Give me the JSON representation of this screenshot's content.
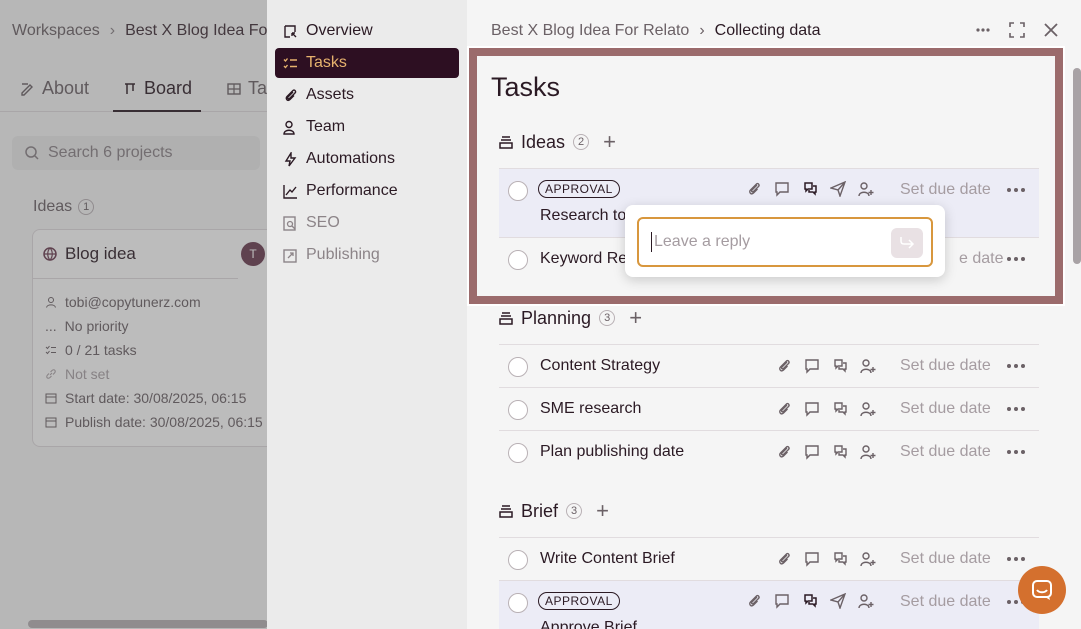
{
  "background": {
    "breadcrumb": {
      "root": "Workspaces",
      "current": "Best X Blog Idea For"
    },
    "tabs": [
      {
        "label": "About"
      },
      {
        "label": "Board"
      },
      {
        "label": "Ta"
      }
    ],
    "search_placeholder": "Search 6 projects",
    "column": {
      "title": "Ideas",
      "count": "1"
    },
    "card": {
      "title": "Blog idea",
      "avatar": "T",
      "email": "tobi@copytunerz.com",
      "priority": "No priority",
      "tasks": "0 / 21 tasks",
      "not_set": "Not set",
      "start_date": "Start date: 30/08/2025, 06:15",
      "publish_date": "Publish date: 30/08/2025, 06:15"
    }
  },
  "nav": {
    "items": [
      {
        "label": "Overview"
      },
      {
        "label": "Tasks"
      },
      {
        "label": "Assets"
      },
      {
        "label": "Team"
      },
      {
        "label": "Automations"
      },
      {
        "label": "Performance"
      },
      {
        "label": "SEO"
      },
      {
        "label": "Publishing"
      }
    ]
  },
  "main": {
    "breadcrumb": {
      "project": "Best X Blog Idea For Relato",
      "current": "Collecting data"
    },
    "title": "Tasks",
    "due_label": "Set due date",
    "sections": [
      {
        "name": "Ideas",
        "count": "2",
        "tasks": [
          {
            "badge": "APPROVAL",
            "title": "Research to"
          },
          {
            "title": "Keyword Re",
            "due_partial": "e date"
          }
        ]
      },
      {
        "name": "Planning",
        "count": "3",
        "tasks": [
          {
            "title": "Content Strategy"
          },
          {
            "title": "SME research"
          },
          {
            "title": "Plan publishing date"
          }
        ]
      },
      {
        "name": "Brief",
        "count": "3",
        "tasks": [
          {
            "title": "Write Content Brief"
          },
          {
            "badge": "APPROVAL",
            "title": "Approve Brief"
          }
        ]
      }
    ]
  },
  "popup": {
    "placeholder": "Leave a reply"
  },
  "colors": {
    "accent": "#2d0f22",
    "accent_text": "#e6b26e",
    "highlight_frame": "#9b6b6c",
    "focus": "#d8973d",
    "chat": "#d4702e"
  }
}
